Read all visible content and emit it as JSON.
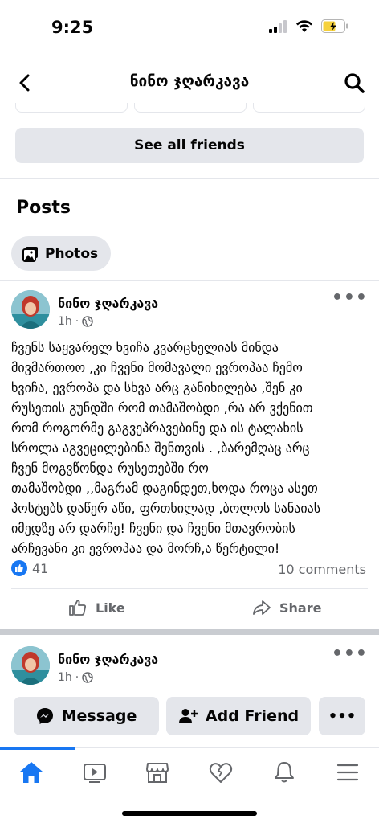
{
  "status": {
    "time": "9:25"
  },
  "nav": {
    "title": "ნინო ჯღარკავა"
  },
  "friends": {
    "see_all_label": "See all friends"
  },
  "posts": {
    "heading": "Posts",
    "photos_label": "Photos"
  },
  "post": {
    "author": "ნინო ჯღარკავა",
    "time": "1h",
    "text_lines": [
      "ჩვენს საყვარელ ხვიჩა კვარცხელიას მინდა",
      "მივმართოო ,კი ჩვენი მომავალი ევროპაა ჩემო",
      "ხვიჩა, ევროპა და სხვა არც განიხილება ,შენ კი",
      "რუსეთის გუნდში რომ თამაშობდი ,რა არ ვქენით",
      "რომ როგორმე გაგვეპრავებინე და ის ტალახის",
      "სროლა აგვეცილებინა შენთვის . ,ბარემღაც არც",
      "ჩვენ მოგვწონდა რუსეთებში რო",
      "თამაშობდი ,,მაგრამ დაგინდეთ,ხოდა როცა ასეთ",
      "პოსტებს დაწერ აწი, ფრთხილად ,ბოლოს სანაიას",
      "იმედზე არ დარჩე! ჩვენი და ჩვენი მთავრობის",
      "არჩევანი კი  ევროპაა და მორჩ,ა წერტილი!"
    ],
    "likes": "41",
    "comments": "10 comments",
    "like_label": "Like",
    "share_label": "Share"
  },
  "post2": {
    "author": "ნინო ჯღარკავა",
    "time": "1h"
  },
  "actions": {
    "message_label": "Message",
    "add_friend_label": "Add Friend"
  },
  "colors": {
    "accent": "#1877f2",
    "button_bg": "#e4e6eb",
    "secondary_text": "#65676b"
  },
  "tabs": [
    "home-icon",
    "watch-icon",
    "marketplace-icon",
    "dating-icon",
    "notifications-icon",
    "menu-icon"
  ]
}
